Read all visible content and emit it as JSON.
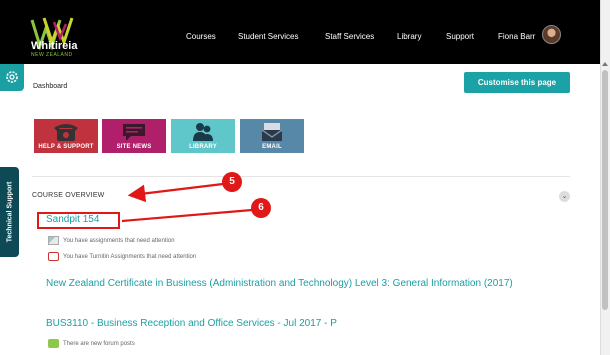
{
  "header": {
    "logo_text": "Whitireia",
    "logo_subtext": "NEW ZEALAND",
    "nav": [
      "Courses",
      "Student Services",
      "Staff Services",
      "Library",
      "Support"
    ],
    "user_name": "Fiona Barr"
  },
  "breadcrumb": "Dashboard",
  "customise_label": "Customise this page",
  "tiles": [
    "HELP & SUPPORT",
    "SITE NEWS",
    "LIBRARY",
    "EMAIL"
  ],
  "side_tab": "Technical Support",
  "course_overview": {
    "title": "COURSE OVERVIEW",
    "courses": [
      {
        "name": "Sandpit 154",
        "notices": [
          "You have assignments that need attention",
          "You have Turnitin Assignments that need attention"
        ]
      },
      {
        "name": "New Zealand Certificate in Business (Administration and Technology) Level 3: General Information (2017)",
        "notices": []
      },
      {
        "name": "BUS3110 - Business Reception and Office Services - Jul 2017 - P",
        "notices": [
          "There are new forum posts"
        ]
      }
    ]
  },
  "annotations": {
    "badge_a": "5",
    "badge_b": "6"
  },
  "colors": {
    "accent": "#1aa2a6",
    "annotation": "#e01818",
    "topbar": "#000000"
  }
}
